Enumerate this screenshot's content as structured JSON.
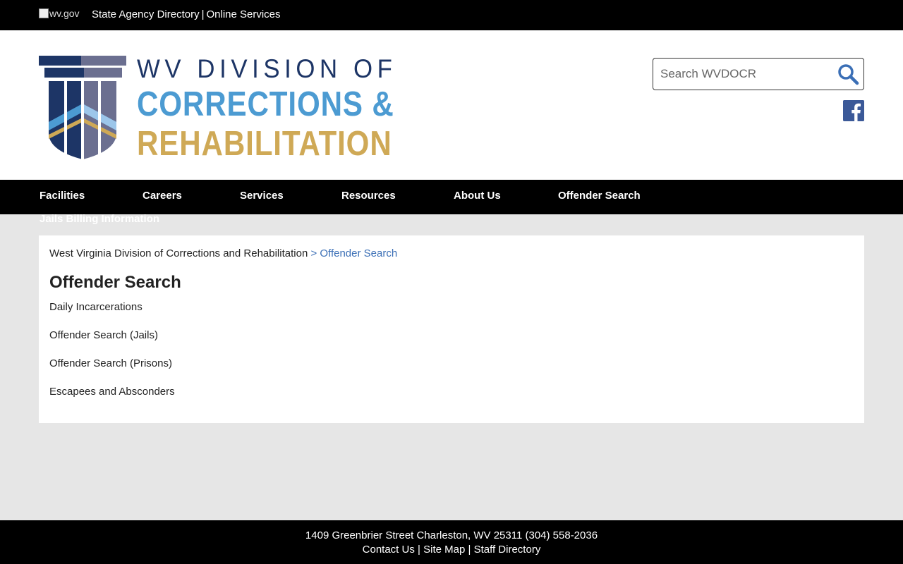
{
  "topbar": {
    "wvgov_alt": "wv.gov",
    "state_agency_directory": "State Agency Directory",
    "separator": "|",
    "online_services": "Online Services"
  },
  "header": {
    "logo": {
      "line1": "WV DIVISION OF",
      "line2": "CORRECTIONS &",
      "line3": "REHABILITATION"
    },
    "search": {
      "placeholder": "Search WVDOCR",
      "icon": "search-icon"
    },
    "social": {
      "icon": "facebook-icon"
    }
  },
  "nav": {
    "items": [
      {
        "label": "Facilities"
      },
      {
        "label": "Careers"
      },
      {
        "label": "Services"
      },
      {
        "label": "Resources"
      },
      {
        "label": "About Us"
      },
      {
        "label": "Offender Search"
      },
      {
        "label": "Jails Billing Information"
      }
    ]
  },
  "main": {
    "breadcrumb": {
      "root": "West Virginia Division of Corrections and Rehabilitation",
      "current": "> Offender Search"
    },
    "title": "Offender Search",
    "links": [
      {
        "label": "Daily Incarcerations"
      },
      {
        "label": "Offender Search (Jails)"
      },
      {
        "label": "Offender Search (Prisons)"
      },
      {
        "label": "Escapees and Absconders"
      }
    ]
  },
  "footer": {
    "address": "1409 Greenbrier Street Charleston, WV 25311 (304) 558-2036",
    "links": [
      {
        "label": "Contact Us"
      },
      {
        "label": "Site Map"
      },
      {
        "label": "Staff Directory"
      }
    ],
    "separator": "|"
  },
  "colors": {
    "navy": "#1d3566",
    "blue": "#4c9bd2",
    "gold": "#cfa956",
    "link_blue": "#3b6fb6",
    "facebook": "#3b5998"
  }
}
